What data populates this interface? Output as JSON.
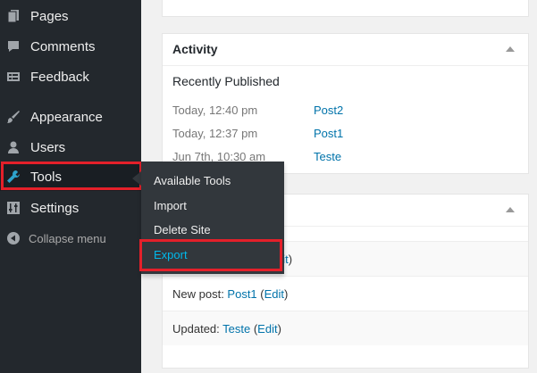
{
  "sidebar": {
    "items": [
      {
        "label": "Pages",
        "icon": "pages-icon"
      },
      {
        "label": "Comments",
        "icon": "comments-icon"
      },
      {
        "label": "Feedback",
        "icon": "feedback-icon"
      },
      {
        "label": "Appearance",
        "icon": "brush-icon"
      },
      {
        "label": "Users",
        "icon": "user-icon"
      },
      {
        "label": "Tools",
        "icon": "wrench-icon"
      },
      {
        "label": "Settings",
        "icon": "sliders-icon"
      }
    ],
    "collapse_label": "Collapse menu"
  },
  "tools_flyout": {
    "items": [
      "Available Tools",
      "Import",
      "Delete Site",
      "Export"
    ],
    "current": "Export"
  },
  "activity": {
    "title": "Activity",
    "section": "Recently Published",
    "published": [
      {
        "date": "Today, 12:40 pm",
        "title": "Post2"
      },
      {
        "date": "Today, 12:37 pm",
        "title": "Post1"
      },
      {
        "date": "Jun 7th, 10:30 am",
        "title": "Teste"
      }
    ]
  },
  "second_card": {
    "rows": [
      {
        "prefix": "",
        "link": "",
        "edit": "dit",
        "paren_open": "",
        "paren_close": ")"
      },
      {
        "prefix": "New post: ",
        "link": "Post1",
        "edit": "Edit",
        "paren_open": " (",
        "paren_close": ")"
      },
      {
        "prefix": "Updated: ",
        "link": "Teste",
        "edit": "Edit",
        "paren_open": " (",
        "paren_close": ")"
      }
    ]
  },
  "colors": {
    "sidebar_bg": "#23282d",
    "highlight_red": "#e4202a",
    "link_blue": "#0073aa",
    "flyout_current": "#00b9eb"
  }
}
